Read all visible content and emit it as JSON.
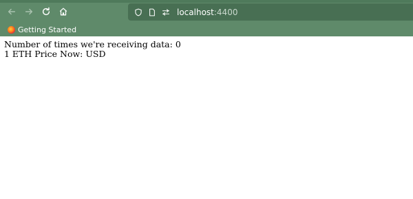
{
  "browser": {
    "url_host": "localhost",
    "url_port": ":4400",
    "bookmarks": [
      {
        "label": "Getting Started",
        "icon": "firefox-icon"
      }
    ],
    "icons": {
      "back": "back-arrow-icon",
      "forward": "forward-arrow-icon",
      "reload": "reload-icon",
      "home": "home-icon",
      "shield": "shield-icon",
      "page": "page-icon",
      "permissions": "permissions-icon"
    },
    "colors": {
      "toolbar": "#5f8a6a",
      "urlbar": "#486f53"
    }
  },
  "page": {
    "data_count_label": "Number of times we're receiving data:",
    "data_count": "0",
    "price_label": "1 ETH Price Now:",
    "price_unit": "USD"
  }
}
